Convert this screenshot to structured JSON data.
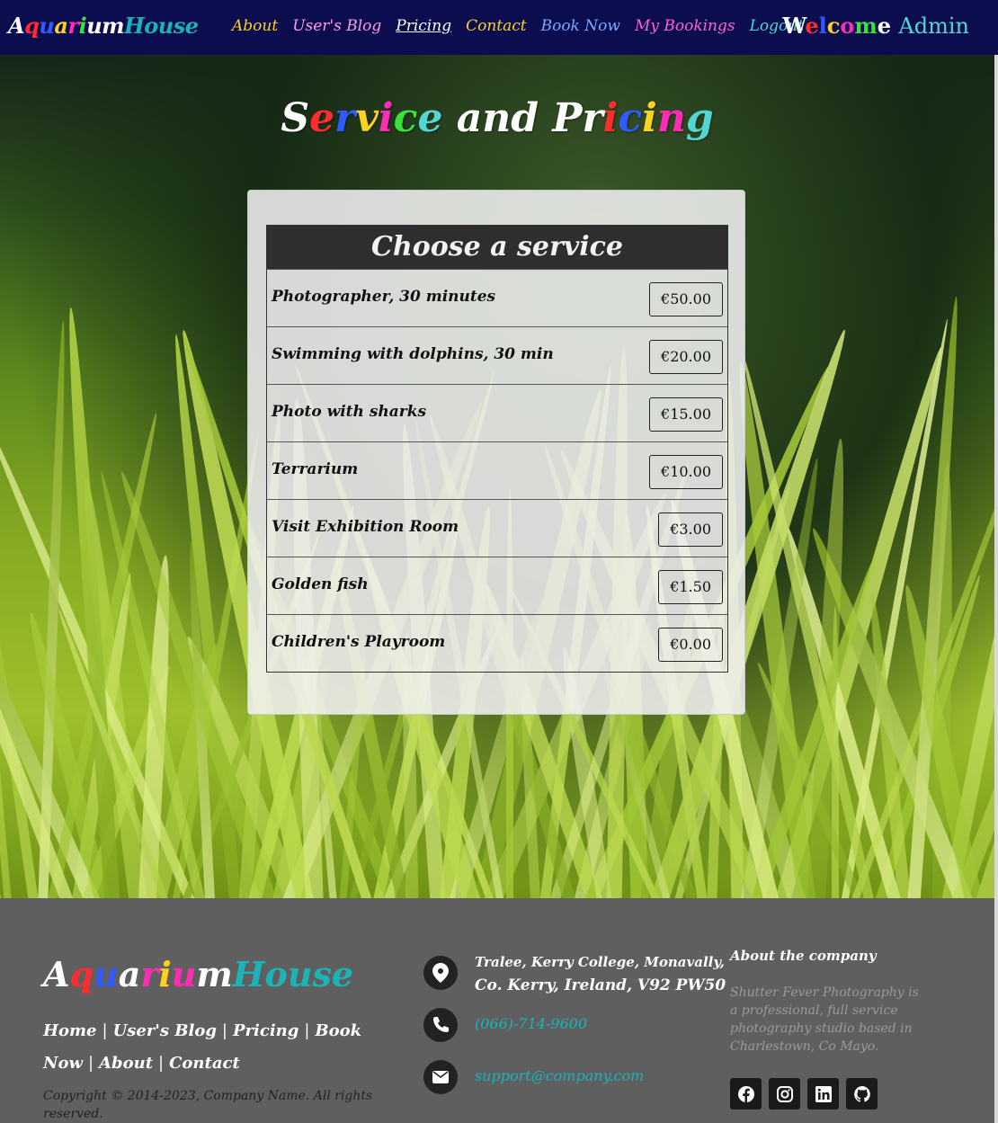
{
  "navbar": {
    "brand": [
      {
        "t": "A",
        "c": "#ffffff"
      },
      {
        "t": "q",
        "c": "#ff2d2d"
      },
      {
        "t": "u",
        "c": "#2f5bff"
      },
      {
        "t": "a",
        "c": "#ffd21f"
      },
      {
        "t": "r",
        "c": "#ff2db6"
      },
      {
        "t": "i",
        "c": "#39e33c"
      },
      {
        "t": "u",
        "c": "#ffffff"
      },
      {
        "t": "m",
        "c": "#ffffff"
      },
      {
        "t": "House",
        "c": "#1bb3b6"
      }
    ],
    "links": [
      {
        "label": "About",
        "color": "#ffd21f",
        "active": false
      },
      {
        "label": "User's Blog",
        "color": "#ff9de2",
        "active": false
      },
      {
        "label": "Pricing",
        "color": "#ffffff",
        "active": true
      },
      {
        "label": "Contact",
        "color": "#ffd21f",
        "active": false
      },
      {
        "label": "Book Now",
        "color": "#7ea8ff",
        "active": false
      },
      {
        "label": "My Bookings",
        "color": "#ff61d8",
        "active": false
      },
      {
        "label": "Logout",
        "color": "#52d6d4",
        "active": false
      }
    ],
    "welcome": "Welcome",
    "welcome_colors": [
      "#ffffff",
      "#ff2d2d",
      "#2f5bff",
      "#ffd21f",
      "#ff2db6",
      "#39e33c",
      "#ffffff"
    ],
    "user": "Admin",
    "user_color": "#52d6d4"
  },
  "hero": {
    "title_parts": [
      {
        "t": "S",
        "c": "#ffffff"
      },
      {
        "t": "e",
        "c": "#ff2d2d"
      },
      {
        "t": "r",
        "c": "#2f5bff"
      },
      {
        "t": "v",
        "c": "#ffd21f"
      },
      {
        "t": "i",
        "c": "#ff2db6"
      },
      {
        "t": "c",
        "c": "#39e33c"
      },
      {
        "t": "e",
        "c": "#52d6d4"
      },
      {
        "t": " and ",
        "c": "#ffffff"
      },
      {
        "t": "P",
        "c": "#ffffff"
      },
      {
        "t": "r",
        "c": "#ffffff"
      },
      {
        "t": "i",
        "c": "#ff2d2d"
      },
      {
        "t": "c",
        "c": "#2f5bff"
      },
      {
        "t": "i",
        "c": "#ffd21f"
      },
      {
        "t": "n",
        "c": "#ff2db6"
      },
      {
        "t": "g",
        "c": "#52d6d4"
      }
    ]
  },
  "pricing": {
    "header": "Choose a service",
    "rows": [
      {
        "name": "Photographer, 30 minutes",
        "price": "€50.00"
      },
      {
        "name": "Swimming with dolphins, 30 min",
        "price": "€20.00"
      },
      {
        "name": "Photo with sharks",
        "price": "€15.00"
      },
      {
        "name": "Terrarium",
        "price": "€10.00"
      },
      {
        "name": "Visit Exhibition Room",
        "price": "€3.00"
      },
      {
        "name": "Golden fish",
        "price": "€1.50"
      },
      {
        "name": "Children's Playroom",
        "price": "€0.00"
      }
    ]
  },
  "footer": {
    "brand": [
      {
        "t": "A",
        "c": "#ffffff"
      },
      {
        "t": "q",
        "c": "#ff2d2d"
      },
      {
        "t": "u",
        "c": "#2f5bff"
      },
      {
        "t": "a",
        "c": "#ffffff"
      },
      {
        "t": "r",
        "c": "#ff2db6"
      },
      {
        "t": "i",
        "c": "#ffd21f"
      },
      {
        "t": "u",
        "c": "#ff2db6"
      },
      {
        "t": "m",
        "c": "#ffffff"
      },
      {
        "t": "House",
        "c": "#1bb3b6"
      }
    ],
    "links": [
      "Home",
      "User's Blog",
      "Pricing",
      "Book Now",
      "About",
      "Contact"
    ],
    "separator": "|",
    "copyright": "Copyright © 2014-2023, Company Name. All rights reserved.",
    "address_line1": "Tralee, Kerry College, Monavally,",
    "address_line2": "Co. Kerry, Ireland, V92 PW50",
    "phone": "(066)-714-9600",
    "email": "support@company.com",
    "about_title": "About the company",
    "about_text": "Shutter Fever Photography is a professional, full service photography studio based in Charlestown, Co Mayo.",
    "social_icons": [
      "facebook-icon",
      "instagram-icon",
      "linkedin-icon",
      "github-icon"
    ]
  }
}
